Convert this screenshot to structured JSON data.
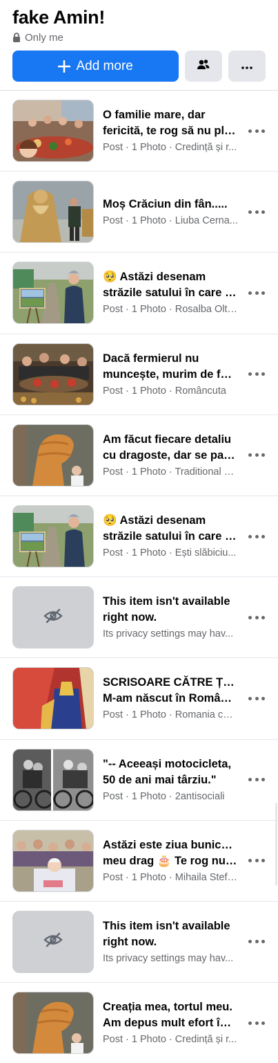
{
  "header": {
    "title": "fake Amin!",
    "privacy_icon": "lock-icon",
    "privacy": "Only me",
    "add_more_label": "Add more"
  },
  "colors": {
    "accent": "#1877f2",
    "meta": "#65676b",
    "button_gray": "#e4e6eb",
    "unavailable_bg": "#ced0d4"
  },
  "items": [
    {
      "line1": "O familie mare, dar",
      "line2": "fericită, te rog să nu plec...",
      "meta": "Post · 1 Photo · Credință și r...",
      "thumb": "family-dinner-photo"
    },
    {
      "line1": "Moș Crăciun din fân.....",
      "line2": "",
      "meta": "Post · 1 Photo · Liuba Cerna...",
      "thumb": "hay-santa-photo"
    },
    {
      "line1": "🥺 Astăzi desenam",
      "line2": "străzile satului în care lo...",
      "meta": "Post · 1 Photo · Rosalba Olte...",
      "thumb": "painting-village-photo"
    },
    {
      "line1": "Dacă fermierul nu",
      "line2": "muncește, murim de foa...",
      "meta": "Post · 1 Photo · Românc­uta",
      "thumb": "farmers-table-photo"
    },
    {
      "line1": "Am făcut fiecare detaliu",
      "line2": "cu dragoste, dar se pare ...",
      "meta": "Post · 1 Photo · Traditional R...",
      "thumb": "bread-horse-photo"
    },
    {
      "line1": "🥺 Astăzi desenam",
      "line2": "străzile satului în care lo...",
      "meta": "Post · 1 Photo · Ești slăbiciu...",
      "thumb": "painting-village-photo"
    },
    {
      "line1": "This item isn't available",
      "line2": "right now.",
      "meta": "Its privacy settings may hav...",
      "thumb": "unavailable"
    },
    {
      "line1": "SCRISOARE CĂTRE ȚARĂ",
      "line2": "M-am născut în Români...",
      "meta": "Post · 1 Photo · Romania cu ...",
      "thumb": "costume-photo"
    },
    {
      "line1": "\"-- Aceeași motocicleta,",
      "line2": "50 de ani mai târziu.\"",
      "meta": "Post · 1 Photo · 2antisociali",
      "thumb": "motorcycle-photo"
    },
    {
      "line1": "Astăzi este ziua bunicului",
      "line2": "meu drag 🎂 Te rog nu p...",
      "meta": "Post · 1 Photo · Mihaila Stefan",
      "thumb": "grandpa-birthday-photo"
    },
    {
      "line1": "This item isn't available",
      "line2": "right now.",
      "meta": "Its privacy settings may hav...",
      "thumb": "unavailable"
    },
    {
      "line1": "Creația mea, tortul meu.",
      "line2": "Am depus mult efort în a...",
      "meta": "Post · 1 Photo · Credință și r...",
      "thumb": "bread-horse-photo"
    }
  ]
}
